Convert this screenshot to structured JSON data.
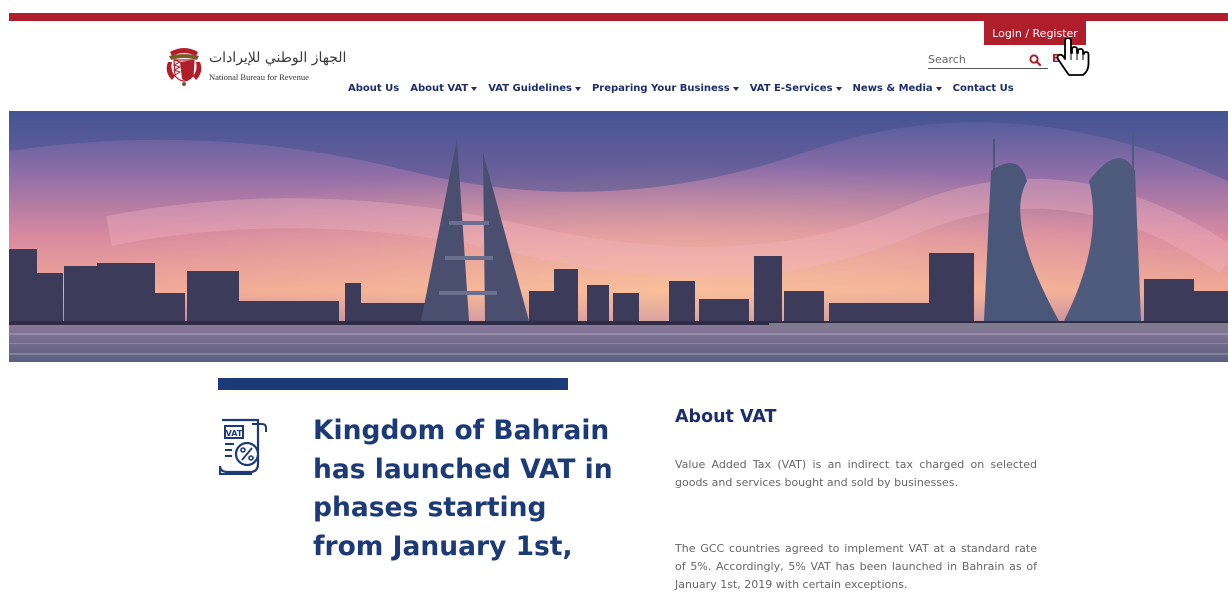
{
  "header": {
    "login_label": "Login / Register",
    "logo_arabic": "الجهاز الوطني للإيرادات",
    "logo_english": "National Bureau for Revenue",
    "search_placeholder": "Search",
    "language_label": "E"
  },
  "nav": {
    "items": [
      {
        "label": "About Us",
        "dropdown": false
      },
      {
        "label": "About VAT",
        "dropdown": true
      },
      {
        "label": "VAT Guidelines",
        "dropdown": true
      },
      {
        "label": "Preparing Your Business",
        "dropdown": true
      },
      {
        "label": "VAT E-Services",
        "dropdown": true
      },
      {
        "label": "News & Media",
        "dropdown": true
      },
      {
        "label": "Contact Us",
        "dropdown": false
      }
    ]
  },
  "feature": {
    "icon_text": "VAT",
    "headline": "Kingdom of Bahrain has launched VAT in phases starting from January 1st,"
  },
  "about": {
    "title": "About VAT",
    "paragraph_1": "Value Added Tax (VAT) is an indirect tax charged on selected goods and services bought and sold by businesses.",
    "paragraph_2": "The GCC countries agreed to implement VAT at a standard rate of 5%. Accordingly, 5% VAT has been launched in Bahrain as of January 1st, 2019 with certain exceptions."
  },
  "colors": {
    "brand_red": "#b01e2b",
    "brand_navy": "#1c2e6b",
    "headline_blue": "#1c3a78"
  },
  "icons": [
    "search-icon",
    "cursor-icon",
    "vat-document-icon",
    "emblem-icon"
  ]
}
